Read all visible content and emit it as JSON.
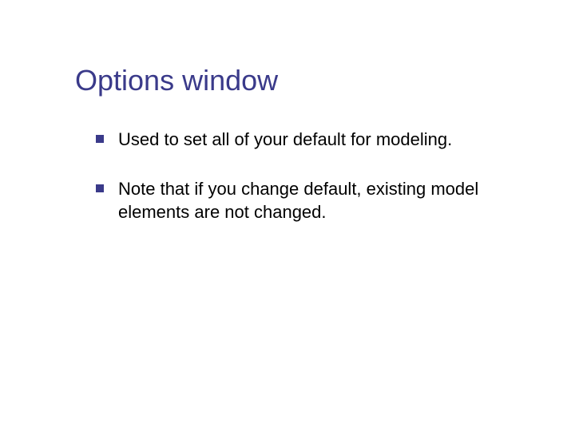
{
  "slide": {
    "title": "Options window",
    "bullets": [
      "Used to set all of your default for modeling.",
      "Note that if you change default, existing model elements are not changed."
    ]
  },
  "colors": {
    "title": "#3a3a8a",
    "bullet_marker": "#3a3a8a",
    "text": "#000000"
  }
}
